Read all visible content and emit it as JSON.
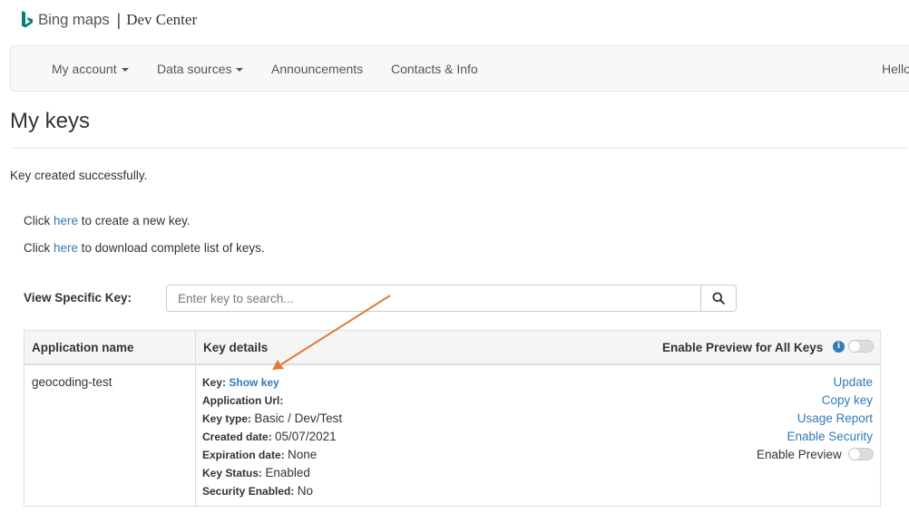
{
  "brand": {
    "name": "Bing maps",
    "separator": "|",
    "section": "Dev Center"
  },
  "nav": {
    "items": [
      {
        "label": "My account"
      },
      {
        "label": "Data sources"
      },
      {
        "label": "Announcements"
      },
      {
        "label": "Contacts & Info"
      }
    ],
    "greeting": "Hello"
  },
  "page": {
    "title": "My keys",
    "success_message": "Key created successfully.",
    "line1": {
      "prefix": "Click ",
      "link": "here",
      "suffix": " to create a new key."
    },
    "line2": {
      "prefix": "Click ",
      "link": "here",
      "suffix": " to download complete list of keys."
    }
  },
  "search": {
    "label": "View Specific Key:",
    "placeholder": "Enter key to search..."
  },
  "table": {
    "headers": {
      "app_name": "Application name",
      "key_details": "Key details",
      "enable_preview_all": "Enable Preview for All Keys"
    },
    "row": {
      "app_name": "geocoding-test",
      "details": {
        "key_label": "Key:",
        "key_link": "Show key",
        "app_url_label": "Application Url:",
        "key_type_label": "Key type:",
        "key_type_value": "Basic / Dev/Test",
        "created_label": "Created date:",
        "created_value": "05/07/2021",
        "expiration_label": "Expiration date:",
        "expiration_value": "None",
        "status_label": "Key Status:",
        "status_value": "Enabled",
        "security_label": "Security Enabled:",
        "security_value": "No"
      },
      "actions": {
        "update": "Update",
        "copy_key": "Copy key",
        "usage_report": "Usage Report",
        "enable_security": "Enable Security",
        "enable_preview": "Enable Preview"
      }
    }
  },
  "colors": {
    "link": "#337ab7",
    "arrow": "#e07b39",
    "logo": "#008272"
  }
}
